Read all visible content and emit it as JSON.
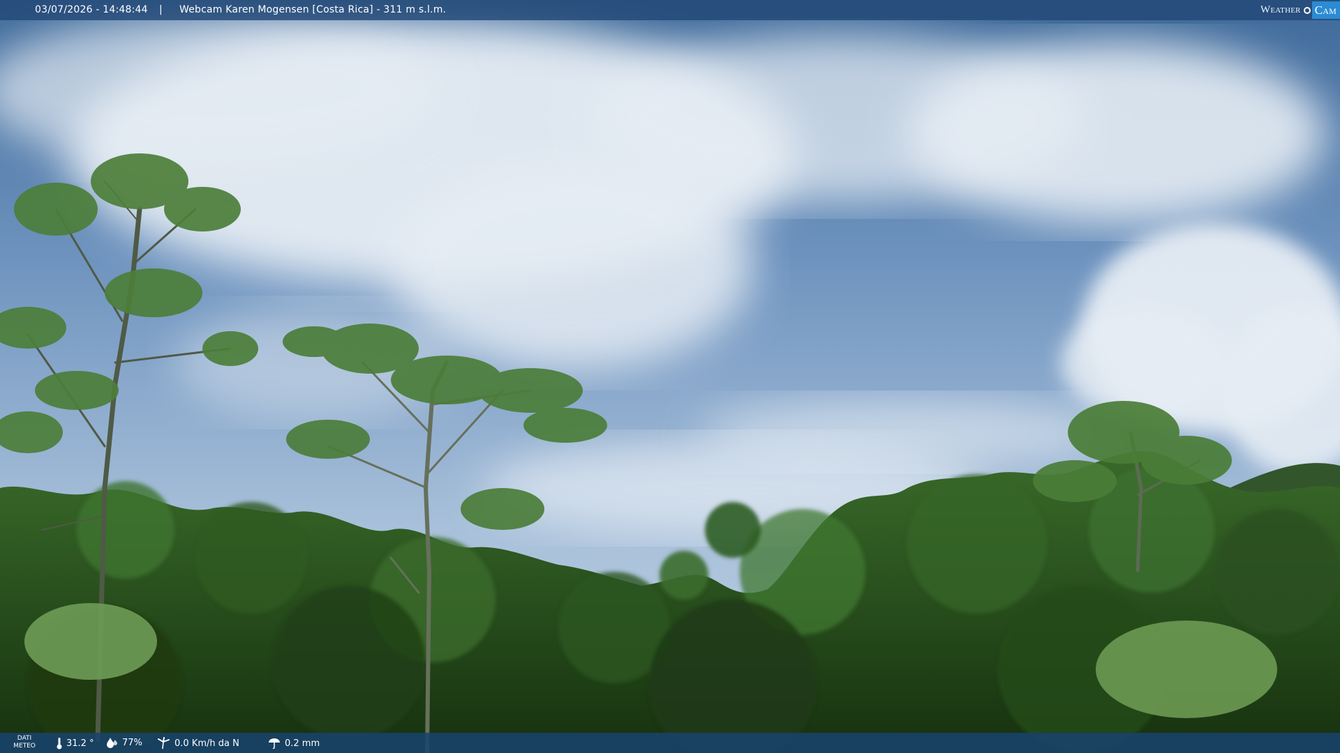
{
  "header": {
    "timestamp": "03/07/2026 - 14:48:44",
    "separator": "|",
    "camera_title": "Webcam Karen Mogensen [Costa Rica] - 311 m s.l.m."
  },
  "brand": {
    "word_weather": "Weather",
    "word_cam": "Cam",
    "accent_color": "#2b8bd3"
  },
  "weather_bar": {
    "label_line1": "DATI",
    "label_line2": "METEO",
    "temperature": "31.2 °",
    "humidity": "77%",
    "wind": "0.0 Km/h da N",
    "rain": "0.2 mm",
    "icons": [
      "thermometer-icon",
      "humidity-icon",
      "wind-icon",
      "rain-icon"
    ]
  },
  "colors": {
    "bar_background": "#224876",
    "sky": "#6f94bf",
    "foliage": "#2f5a22"
  }
}
